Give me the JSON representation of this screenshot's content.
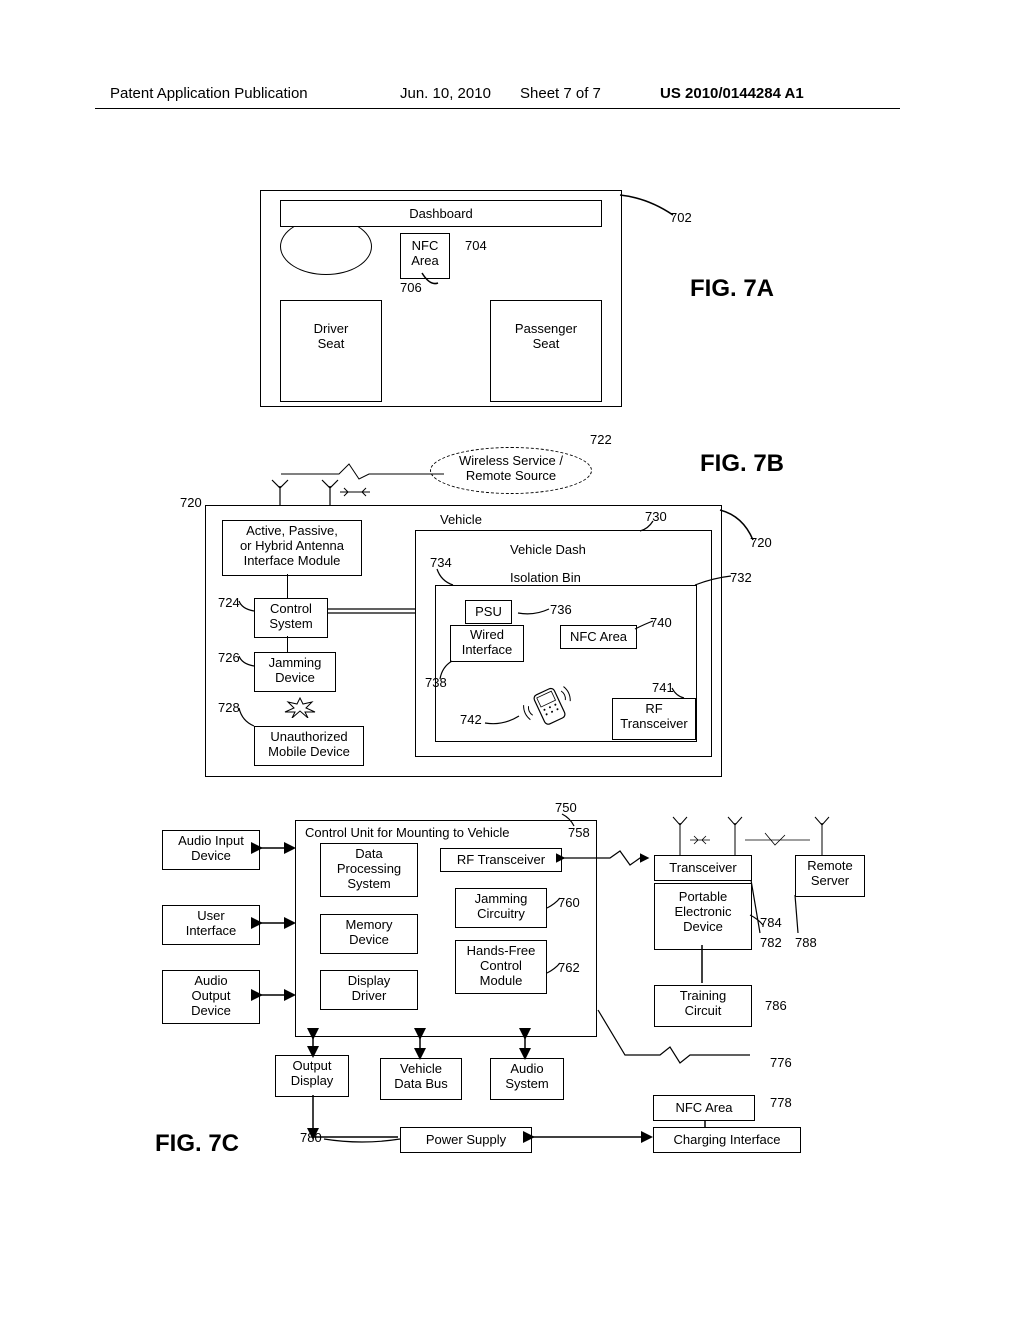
{
  "header": {
    "pub": "Patent Application Publication",
    "date": "Jun. 10, 2010",
    "sheet": "Sheet 7 of 7",
    "pubno": "US 2010/0144284 A1"
  },
  "fig7a": {
    "title": "FIG. 7A",
    "dashboard": "Dashboard",
    "nfc": "NFC\nArea",
    "driver": "Driver\nSeat",
    "passenger": "Passenger\nSeat",
    "ref702": "702",
    "ref704": "704",
    "ref706": "706"
  },
  "fig7b": {
    "title": "FIG. 7B",
    "wireless": "Wireless Service /\nRemote Source",
    "vehicle": "Vehicle",
    "antenna": "Active, Passive,\nor Hybrid Antenna\nInterface Module",
    "control": "Control\nSystem",
    "jamming": "Jamming\nDevice",
    "unauth": "Unauthorized\nMobile Device",
    "dash": "Vehicle Dash",
    "iso": "Isolation Bin",
    "psu": "PSU",
    "wired": "Wired\nInterface",
    "nfc": "NFC Area",
    "rft": "RF\nTransceiver",
    "ref720a": "720",
    "ref720b": "720",
    "ref722": "722",
    "ref724": "724",
    "ref726": "726",
    "ref728": "728",
    "ref730": "730",
    "ref732": "732",
    "ref734": "734",
    "ref736": "736",
    "ref738": "738",
    "ref740": "740",
    "ref741": "741",
    "ref742": "742"
  },
  "fig7c": {
    "title": "FIG. 7C",
    "audioin": "Audio Input\nDevice",
    "ui": "User\nInterface",
    "audioout": "Audio\nOutput\nDevice",
    "cumount": "Control Unit for Mounting to Vehicle",
    "dps": "Data\nProcessing\nSystem",
    "mem": "Memory\nDevice",
    "dispdrv": "Display\nDriver",
    "rft": "RF Transceiver",
    "jam": "Jamming\nCircuitry",
    "hfree": "Hands-Free\nControl\nModule",
    "trans": "Transceiver",
    "ped": "Portable\nElectronic\nDevice",
    "train": "Training\nCircuit",
    "remote": "Remote\nServer",
    "outdisp": "Output\nDisplay",
    "vbus": "Vehicle\nData Bus",
    "audiosys": "Audio\nSystem",
    "nfc": "NFC Area",
    "charge": "Charging Interface",
    "psu": "Power Supply",
    "ref750": "750",
    "ref758": "758",
    "ref760": "760",
    "ref762": "762",
    "ref776": "776",
    "ref778": "778",
    "ref780": "780",
    "ref782": "782",
    "ref784": "784",
    "ref786": "786",
    "ref788": "788"
  }
}
